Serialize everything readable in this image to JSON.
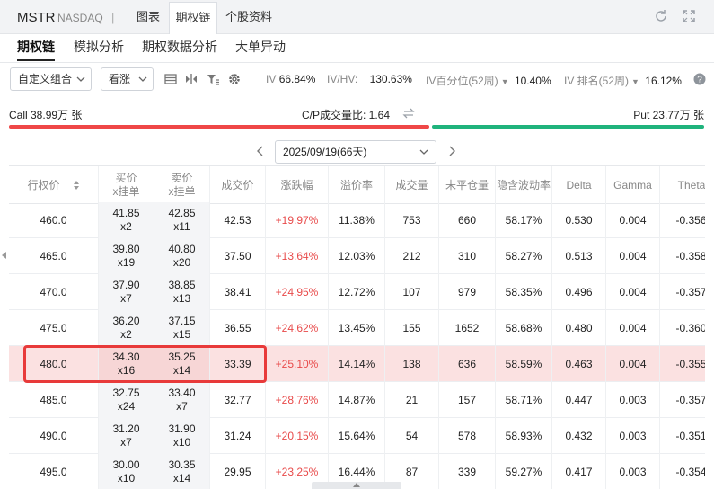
{
  "header": {
    "ticker": "MSTR",
    "exchange": "NASDAQ",
    "separator": "|",
    "tabs": [
      {
        "label": "图表",
        "active": false
      },
      {
        "label": "期权链",
        "active": true
      },
      {
        "label": "个股资料",
        "active": false
      }
    ]
  },
  "subtabs": [
    {
      "label": "期权链",
      "active": true
    },
    {
      "label": "模拟分析",
      "active": false
    },
    {
      "label": "期权数据分析",
      "active": false
    },
    {
      "label": "大单异动",
      "active": false
    }
  ],
  "controls": {
    "combo_select": "自定义组合",
    "direction_select": "看涨",
    "iv": {
      "label": "IV",
      "value": "66.84%"
    },
    "ivhv": {
      "label": "IV/HV:",
      "value": "130.63%"
    },
    "iv_pct": {
      "label": "IV百分位(52周)",
      "value": "10.40%"
    },
    "iv_rank": {
      "label": "IV 排名(52周)",
      "value": "16.12%"
    }
  },
  "cp": {
    "call": "Call 38.99万 张",
    "ratio": "C/P成交量比:  1.64",
    "put": "Put 23.77万 张",
    "call_share": 0.62
  },
  "expiry": {
    "selected": "2025/09/19(66天)"
  },
  "table": {
    "headers": {
      "strike": "行权价",
      "bid": "买价\nx挂单",
      "ask": "卖价\nx挂单",
      "last": "成交价",
      "change": "涨跌幅",
      "premium": "溢价率",
      "volume": "成交量",
      "oi": "未平仓量",
      "iv": "隐含波动率",
      "delta": "Delta",
      "gamma": "Gamma",
      "theta": "Theta"
    },
    "rows": [
      {
        "strike": "460.0",
        "bid": "41.85",
        "bid_size": "x2",
        "ask": "42.85",
        "ask_size": "x11",
        "last": "42.53",
        "change": "+19.97%",
        "premium": "11.38%",
        "volume": "753",
        "oi": "660",
        "iv": "58.17%",
        "delta": "0.530",
        "gamma": "0.004",
        "theta": "-0.356"
      },
      {
        "strike": "465.0",
        "bid": "39.80",
        "bid_size": "x19",
        "ask": "40.80",
        "ask_size": "x20",
        "last": "37.50",
        "change": "+13.64%",
        "premium": "12.03%",
        "volume": "212",
        "oi": "310",
        "iv": "58.27%",
        "delta": "0.513",
        "gamma": "0.004",
        "theta": "-0.358"
      },
      {
        "strike": "470.0",
        "bid": "37.90",
        "bid_size": "x7",
        "ask": "38.85",
        "ask_size": "x13",
        "last": "38.41",
        "change": "+24.95%",
        "premium": "12.72%",
        "volume": "107",
        "oi": "979",
        "iv": "58.35%",
        "delta": "0.496",
        "gamma": "0.004",
        "theta": "-0.357"
      },
      {
        "strike": "475.0",
        "bid": "36.20",
        "bid_size": "x2",
        "ask": "37.15",
        "ask_size": "x15",
        "last": "36.55",
        "change": "+24.62%",
        "premium": "13.45%",
        "volume": "155",
        "oi": "1652",
        "iv": "58.68%",
        "delta": "0.480",
        "gamma": "0.004",
        "theta": "-0.360"
      },
      {
        "strike": "480.0",
        "bid": "34.30",
        "bid_size": "x16",
        "ask": "35.25",
        "ask_size": "x14",
        "last": "33.39",
        "change": "+25.10%",
        "premium": "14.14%",
        "volume": "138",
        "oi": "636",
        "iv": "58.59%",
        "delta": "0.463",
        "gamma": "0.004",
        "theta": "-0.355",
        "highlight": true
      },
      {
        "strike": "485.0",
        "bid": "32.75",
        "bid_size": "x24",
        "ask": "33.40",
        "ask_size": "x7",
        "last": "32.77",
        "change": "+28.76%",
        "premium": "14.87%",
        "volume": "21",
        "oi": "157",
        "iv": "58.71%",
        "delta": "0.447",
        "gamma": "0.003",
        "theta": "-0.357"
      },
      {
        "strike": "490.0",
        "bid": "31.20",
        "bid_size": "x7",
        "ask": "31.90",
        "ask_size": "x10",
        "last": "31.24",
        "change": "+20.15%",
        "premium": "15.64%",
        "volume": "54",
        "oi": "578",
        "iv": "58.93%",
        "delta": "0.432",
        "gamma": "0.003",
        "theta": "-0.351"
      },
      {
        "strike": "495.0",
        "bid": "30.00",
        "bid_size": "x10",
        "ask": "30.35",
        "ask_size": "x14",
        "last": "29.95",
        "change": "+23.25%",
        "premium": "16.44%",
        "volume": "87",
        "oi": "339",
        "iv": "59.27%",
        "delta": "0.417",
        "gamma": "0.003",
        "theta": "-0.354"
      }
    ]
  },
  "colors": {
    "up": "#e84a4a",
    "call_bar": "#ef4747",
    "put_bar": "#1fb37c",
    "highlight_row": "#fbe1e1",
    "selection_border": "#e83a3a"
  }
}
